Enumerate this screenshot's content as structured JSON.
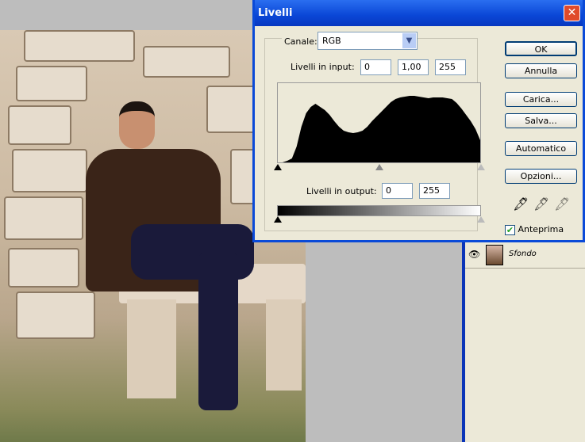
{
  "dialog": {
    "title": "Livelli",
    "close": "✕",
    "channel_label": "Canale:",
    "channel_value": "RGB",
    "input_label": "Livelli in input:",
    "input_black": "0",
    "input_gamma": "1,00",
    "input_white": "255",
    "output_label": "Livelli in output:",
    "output_black": "0",
    "output_white": "255",
    "buttons": {
      "ok": "OK",
      "cancel": "Annulla",
      "load": "Carica...",
      "save": "Salva...",
      "auto": "Automatico",
      "options": "Opzioni..."
    },
    "preview_label": "Anteprima",
    "preview_checked": true,
    "histogram": [
      0,
      0,
      2,
      5,
      20,
      45,
      62,
      70,
      74,
      70,
      66,
      60,
      52,
      45,
      40,
      38,
      37,
      38,
      40,
      45,
      52,
      58,
      64,
      70,
      76,
      80,
      82,
      83,
      84,
      84,
      83,
      82,
      81,
      82,
      82,
      82,
      81,
      80,
      75,
      68,
      60,
      52,
      42,
      28
    ]
  },
  "layers": {
    "name": "Sfondo"
  }
}
